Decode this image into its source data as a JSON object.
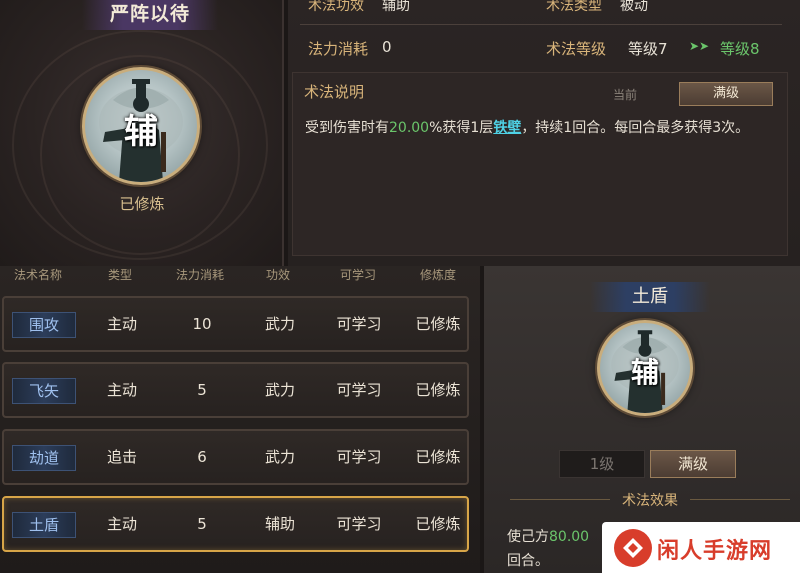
{
  "skill_card": {
    "title": "严阵以待",
    "avatar_glyph": "辅",
    "status": "已修炼"
  },
  "info": {
    "effect_label": "术法功效",
    "effect_value": "辅助",
    "type_label": "术法类型",
    "type_value": "被动",
    "cost_label": "法力消耗",
    "cost_value": "0",
    "level_label": "术法等级",
    "level_current": "等级7",
    "level_arrow": "➤➤",
    "level_next": "等级8"
  },
  "description": {
    "title": "术法说明",
    "tab_current": "当前",
    "tab_max": "满级",
    "text_before": "受到伤害时有",
    "text_pct": "20.00",
    "text_mid": "%获得1层",
    "text_keyword": "铁壁",
    "text_after": "，持续1回合。每回合最多获得3次。"
  },
  "table": {
    "headers": [
      "法术名称",
      "类型",
      "法力消耗",
      "功效",
      "可学习",
      "修炼度"
    ],
    "rows": [
      {
        "name": "围攻",
        "type": "主动",
        "cost": "10",
        "effect": "武力",
        "learn": "可学习",
        "status": "已修炼",
        "selected": false
      },
      {
        "name": "飞矢",
        "type": "主动",
        "cost": "5",
        "effect": "武力",
        "learn": "可学习",
        "status": "已修炼",
        "selected": false
      },
      {
        "name": "劫道",
        "type": "追击",
        "cost": "6",
        "effect": "武力",
        "learn": "可学习",
        "status": "已修炼",
        "selected": false
      },
      {
        "name": "土盾",
        "type": "主动",
        "cost": "5",
        "effect": "辅助",
        "learn": "可学习",
        "status": "已修炼",
        "selected": true
      }
    ]
  },
  "detail": {
    "name": "土盾",
    "avatar_glyph": "辅",
    "level_min_button": "1级",
    "level_max_button": "满级",
    "effect_title": "术法效果",
    "effect_text_prefix": "使己方",
    "effect_text_pct": "80.00",
    "effect_text_line2": "回合。"
  },
  "watermark": {
    "text": "闲人手游网"
  },
  "colors": {
    "accent_gold": "#d8b47a",
    "green": "#6bc56b",
    "keyword_cyan": "#4fd2e6",
    "selected_border": "#d7a548",
    "name_tag_blue": "#9fc0ee"
  }
}
